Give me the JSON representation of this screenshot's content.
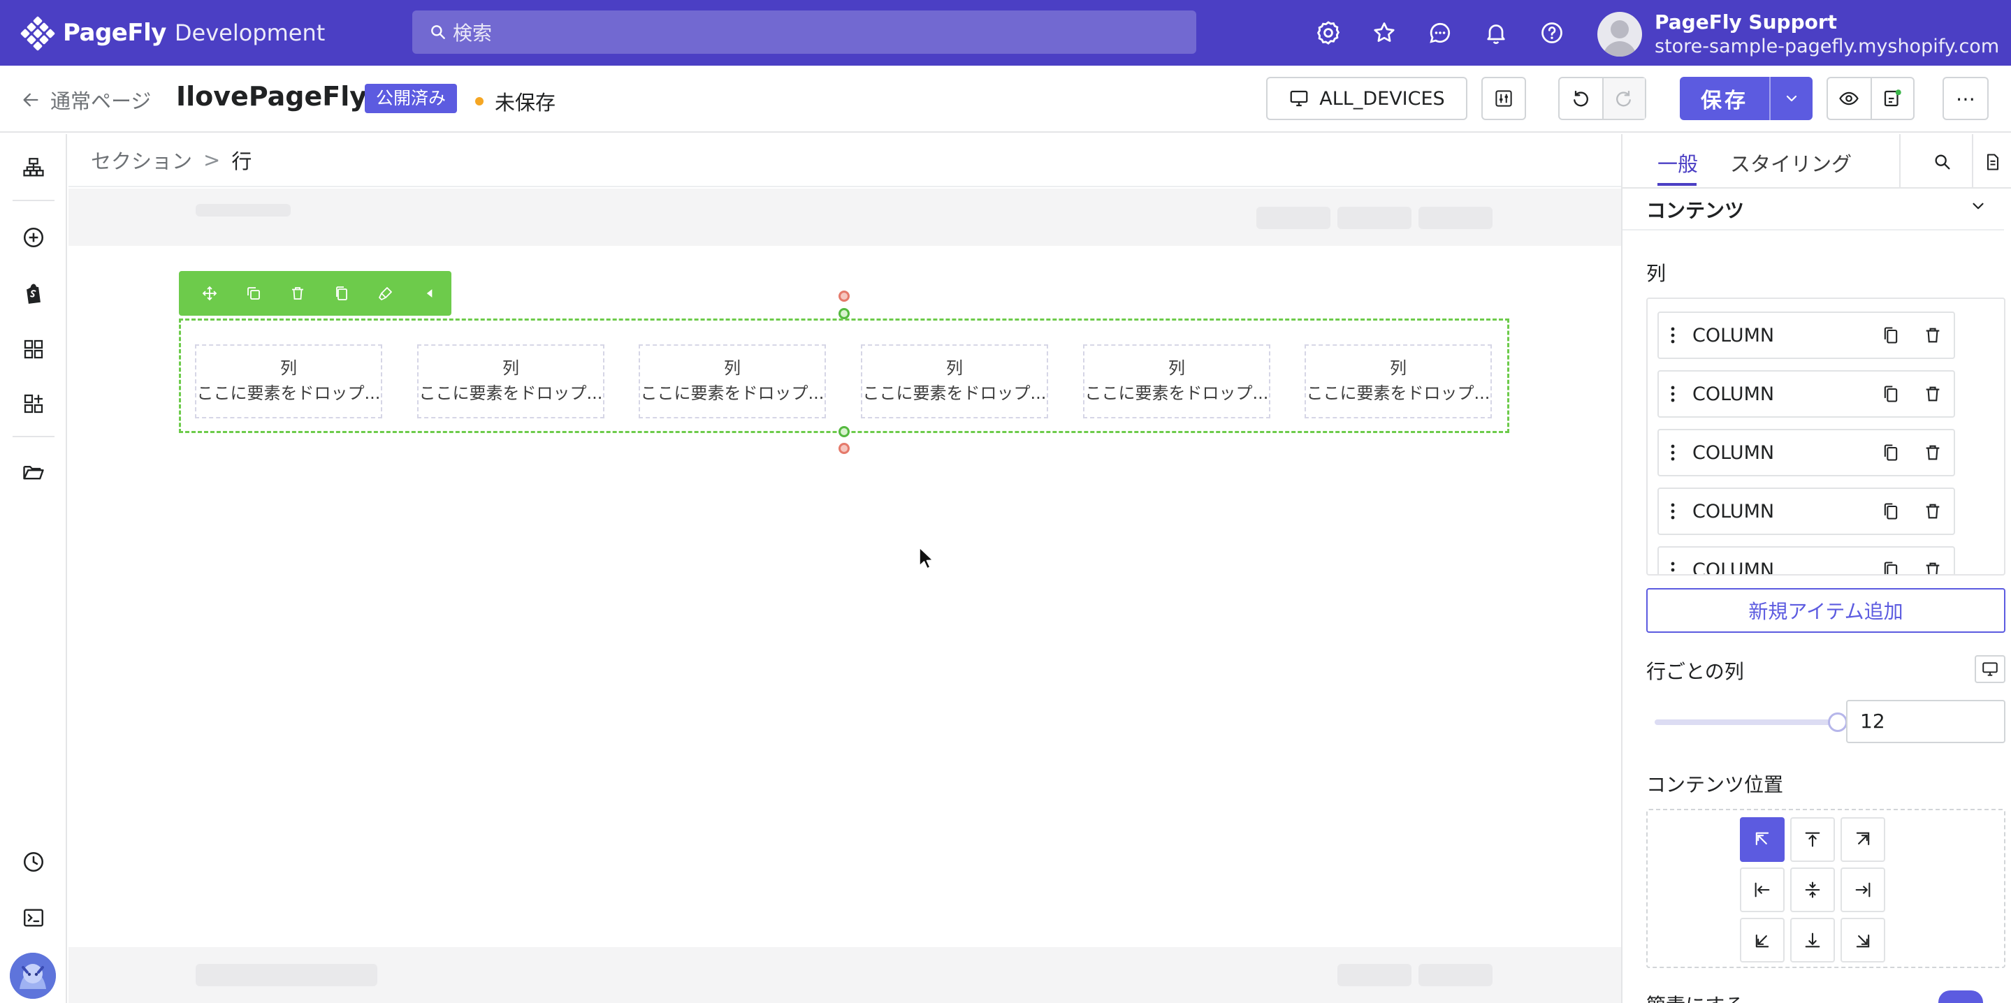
{
  "topbar": {
    "brand": "PageFly",
    "env": "Development",
    "search_placeholder": "検索",
    "user_name": "PageFly Support",
    "user_store": "store-sample-pagefly.myshopify.com"
  },
  "page_header": {
    "back_label": "通常ページ",
    "title": "IlovePageFly",
    "status_badge": "公開済み",
    "unsaved_label": "未保存",
    "device_label": "ALL_DEVICES",
    "save_label": "保存",
    "more_label": "⋯"
  },
  "breadcrumb": {
    "parent": "セクション",
    "separator": ">",
    "current": "行"
  },
  "row": {
    "columns": [
      {
        "title": "列",
        "drop": "ここに要素をドロップ..."
      },
      {
        "title": "列",
        "drop": "ここに要素をドロップ..."
      },
      {
        "title": "列",
        "drop": "ここに要素をドロップ..."
      },
      {
        "title": "列",
        "drop": "ここに要素をドロップ..."
      },
      {
        "title": "列",
        "drop": "ここに要素をドロップ..."
      },
      {
        "title": "列",
        "drop": "ここに要素をドロップ..."
      }
    ]
  },
  "panel": {
    "tab_general": "一般",
    "tab_styling": "スタイリング",
    "section_title": "コンテンツ",
    "columns_label": "列",
    "column_items": [
      "COLUMN",
      "COLUMN",
      "COLUMN",
      "COLUMN",
      "COLUMN"
    ],
    "add_item_label": "新規アイテム追加",
    "cols_per_row_label": "行ごとの列",
    "cols_per_row_value": "12",
    "content_position_label": "コンテンツ位置",
    "selected_position": "top-left",
    "cut_label": "簡素にする"
  },
  "colors": {
    "brand": "#4b3fc4",
    "accent": "#5c5be0",
    "selection_green": "#6dcb4b"
  }
}
